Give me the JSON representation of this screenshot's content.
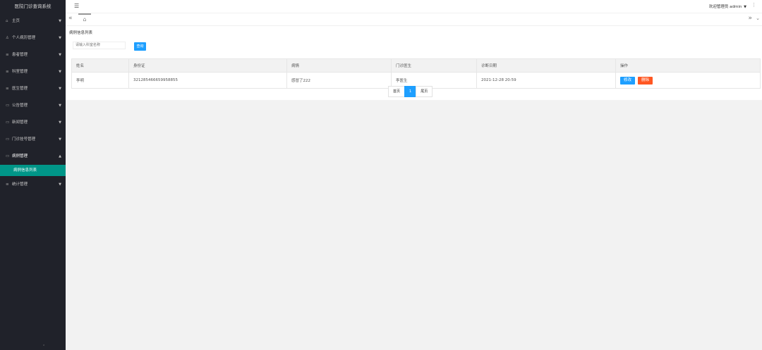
{
  "app": {
    "title": "医院门诊查询系统"
  },
  "header": {
    "menu_icon": "☰",
    "welcome": "欢迎管理员 admin",
    "caret": "▼",
    "more": "⋮"
  },
  "tabs": {
    "prev": "«",
    "home_icon": "⌂",
    "next": "»",
    "dropdown": "⌄"
  },
  "sidebar": {
    "items": [
      {
        "icon": "⌂",
        "label": "主页",
        "arrow": "▼"
      },
      {
        "icon": "♙",
        "label": "个人病历管理",
        "arrow": "▼"
      },
      {
        "icon": "≡",
        "label": "患者管理",
        "arrow": "▼"
      },
      {
        "icon": "≡",
        "label": "科室管理",
        "arrow": "▼"
      },
      {
        "icon": "≡",
        "label": "医生管理",
        "arrow": "▼"
      },
      {
        "icon": "▭",
        "label": "公告管理",
        "arrow": "▼"
      },
      {
        "icon": "▭",
        "label": "新闻管理",
        "arrow": "▼"
      },
      {
        "icon": "▭",
        "label": "门诊挂号管理",
        "arrow": "▼"
      },
      {
        "icon": "▭",
        "label": "病例管理",
        "arrow": "▲"
      }
    ],
    "submenu_label": "病例信息列表",
    "last_item": {
      "icon": "≡",
      "label": "统计管理",
      "arrow": "▼"
    },
    "footer": "⌃"
  },
  "main": {
    "page_title": "病例信息列表",
    "search": {
      "placeholder": "请输入科室名称",
      "button": "查询"
    },
    "table": {
      "headers": [
        "姓名",
        "身份证",
        "病情",
        "门诊医生",
        "诊断日期",
        "操作"
      ],
      "rows": [
        [
          "李明",
          "321285466659958855",
          "感冒了222",
          "李医生",
          "2021-12-28 20:59"
        ]
      ],
      "edit_label": "修改",
      "delete_label": "删除"
    },
    "pagination": {
      "first": "首页",
      "current": "1",
      "last": "尾页"
    }
  }
}
